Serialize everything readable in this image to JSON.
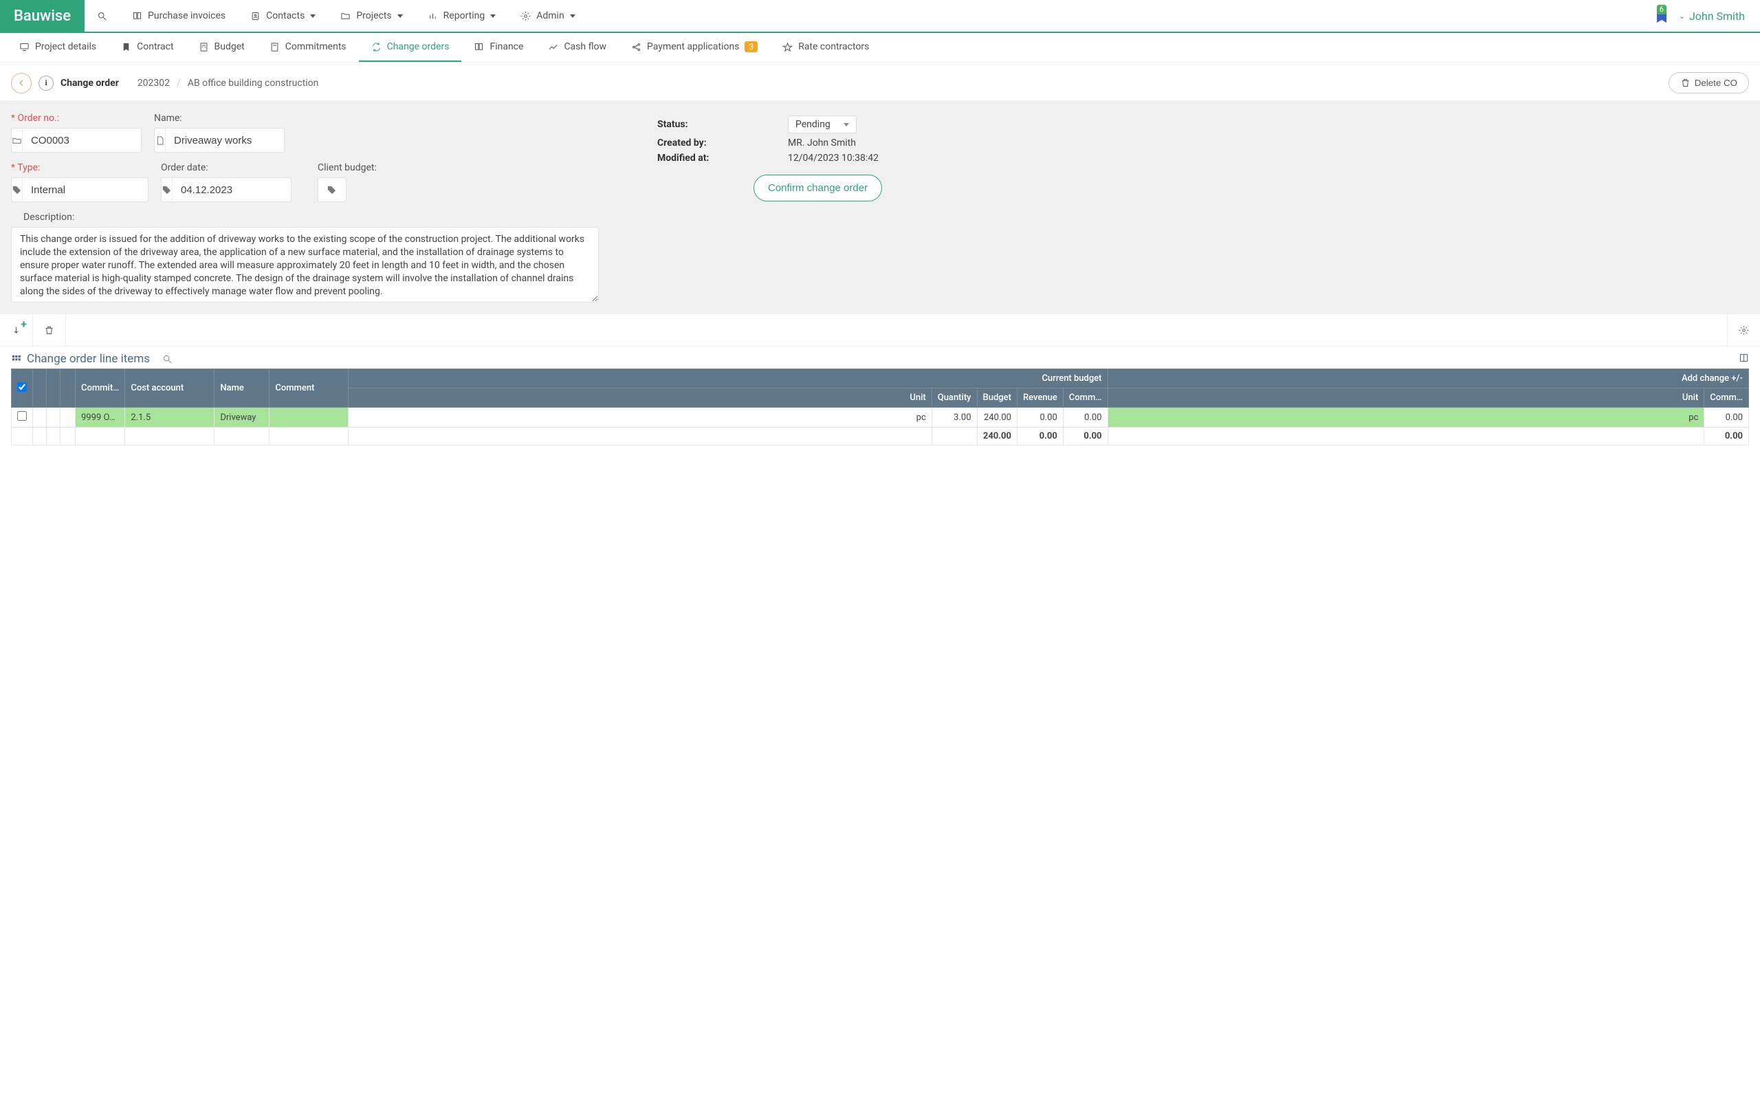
{
  "brand": "Bauwise",
  "topnav": {
    "items": [
      {
        "label": "Purchase invoices",
        "icon": "book"
      },
      {
        "label": "Contacts",
        "icon": "contact",
        "caret": true
      },
      {
        "label": "Projects",
        "icon": "folder",
        "caret": true
      },
      {
        "label": "Reporting",
        "icon": "chart",
        "caret": true
      },
      {
        "label": "Admin",
        "icon": "gear",
        "caret": true
      }
    ],
    "notif_count": "6",
    "user_name": "John Smith"
  },
  "subtabs": [
    {
      "label": "Project details",
      "icon": "monitor"
    },
    {
      "label": "Contract",
      "icon": "bookmark"
    },
    {
      "label": "Budget",
      "icon": "calc"
    },
    {
      "label": "Commitments",
      "icon": "calc"
    },
    {
      "label": "Change orders",
      "icon": "refresh",
      "active": true
    },
    {
      "label": "Finance",
      "icon": "book"
    },
    {
      "label": "Cash flow",
      "icon": "line"
    },
    {
      "label": "Payment applications",
      "icon": "share",
      "pill": "3"
    },
    {
      "label": "Rate contractors",
      "icon": "star"
    }
  ],
  "breadcrumb": {
    "title": "Change order",
    "project_no": "202302",
    "project_name": "AB office building construction",
    "delete_label": "Delete CO"
  },
  "form": {
    "order_no_label": "* Order no.:",
    "order_no": "CO0003",
    "name_label": "Name:",
    "name": "Driveaway works",
    "type_label": "* Type:",
    "type": "Internal",
    "order_date_label": "Order date:",
    "order_date": "04.12.2023",
    "client_budget_label": "Client budget:",
    "client_budget": "",
    "description_label": "Description:",
    "description": "This change order is issued for the addition of driveway works to the existing scope of the construction project. The additional works include the extension of the driveway area, the application of a new surface material, and the installation of drainage systems to ensure proper water runoff. The extended area will measure approximately 20 feet in length and 10 feet in width, and the chosen surface material is high-quality stamped concrete. The design of the drainage system will involve the installation of channel drains along the sides of the driveway to effectively manage water flow and prevent pooling."
  },
  "meta": {
    "status_label": "Status:",
    "status_value": "Pending",
    "created_label": "Created by:",
    "created_value": "MR. John Smith",
    "modified_label": "Modified at:",
    "modified_value": "12/04/2023 10:38:42",
    "confirm_label": "Confirm change order"
  },
  "table": {
    "title": "Change order line items",
    "headers": {
      "commit": "Commit…",
      "cost_account": "Cost account",
      "name": "Name",
      "comment": "Comment",
      "current_budget": "Current budget",
      "unit": "Unit",
      "quantity": "Quantity",
      "budget": "Budget",
      "revenue": "Revenue",
      "comm2": "Comm…",
      "add_change": "Add change +/-",
      "unit2": "Unit",
      "comm3": "Comm…"
    },
    "row": {
      "commit": "9999 O…",
      "cost_account": "2.1.5",
      "name": "Driveway",
      "comment": "",
      "unit": "pc",
      "quantity": "3.00",
      "budget": "240.00",
      "revenue": "0.00",
      "comm2": "0.00",
      "unit2": "pc",
      "comm3": "0.00"
    },
    "totals": {
      "budget": "240.00",
      "revenue": "0.00",
      "comm2": "0.00",
      "comm3": "0.00"
    }
  }
}
